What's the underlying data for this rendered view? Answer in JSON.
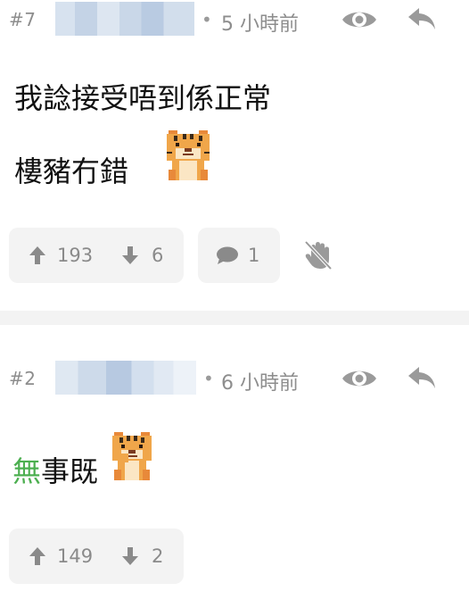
{
  "posts": [
    {
      "floor": "#7",
      "separator": "•",
      "time": "5 小時前",
      "lines": [
        "我諗接受唔到係正常",
        "樓豬冇錯"
      ],
      "upvotes": "193",
      "downvotes": "6",
      "comments": "1",
      "icons": [
        "eye-icon",
        "reply-icon",
        "thumb-up-icon",
        "thumb-down-icon",
        "comment-icon",
        "block-hand-icon"
      ]
    },
    {
      "floor": "#2",
      "separator": "•",
      "time": "6 小時前",
      "content_green": "無",
      "content_rest": "事既",
      "upvotes": "149",
      "downvotes": "2",
      "icons": [
        "eye-icon",
        "reply-icon",
        "thumb-up-icon",
        "thumb-down-icon"
      ]
    }
  ],
  "colors": {
    "meta_gray": "#8d8d8d",
    "button_bg": "#f3f3f3",
    "green_text": "#4caf50",
    "divider": "#f3f3f3"
  }
}
